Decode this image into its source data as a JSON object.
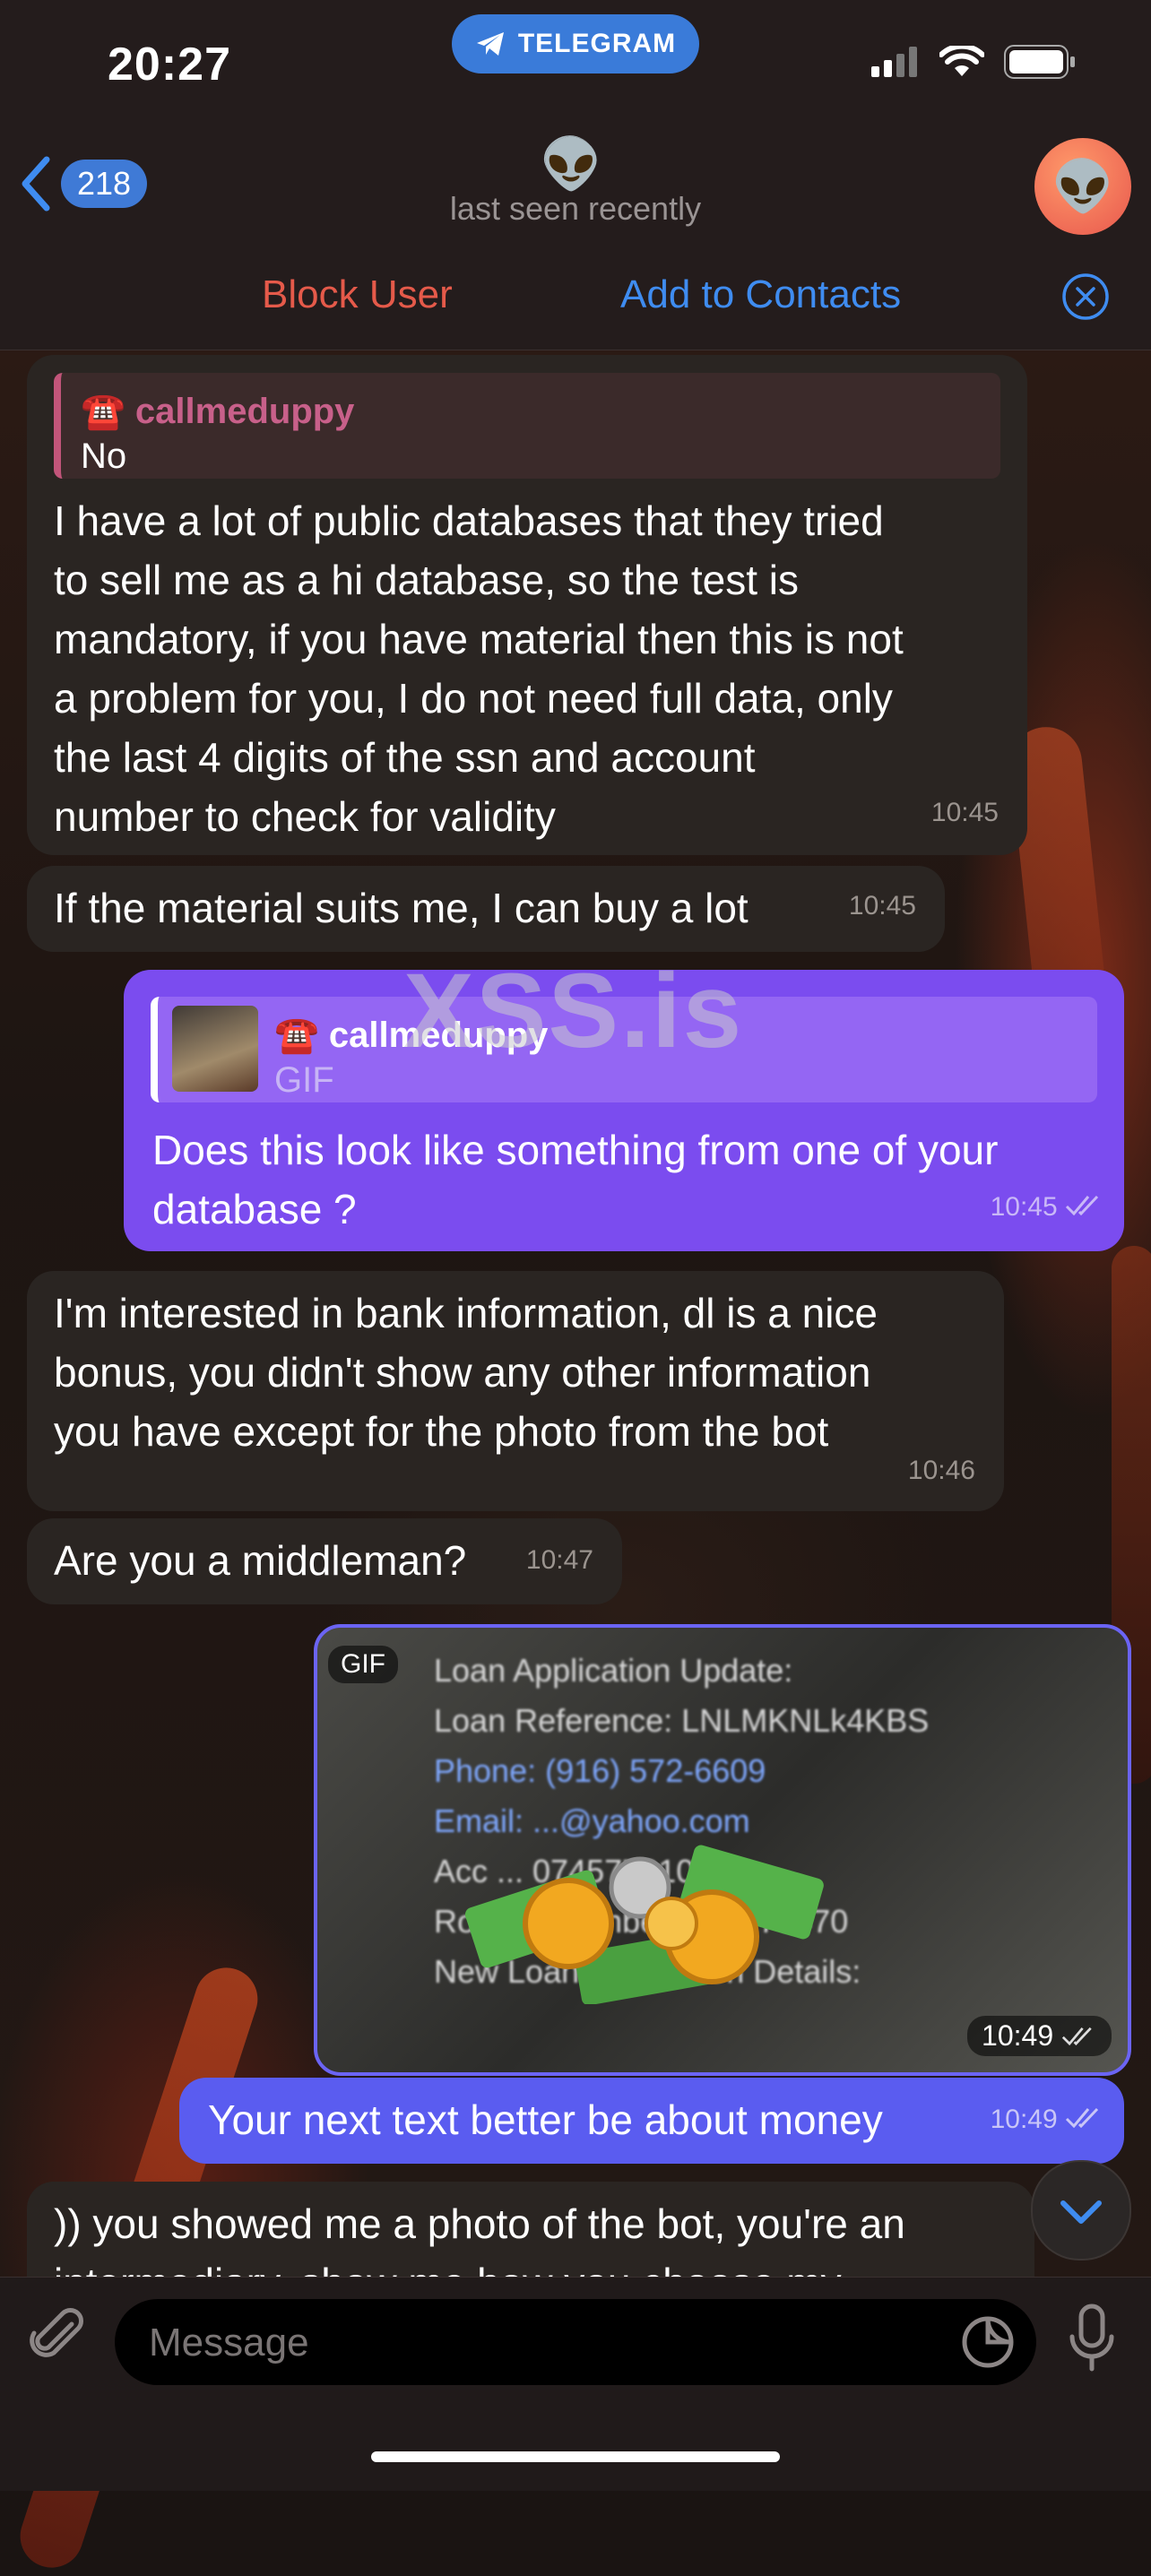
{
  "status_bar": {
    "time": "20:27",
    "app_pill": "TELEGRAM"
  },
  "header": {
    "back_count": "218",
    "peer_emoji": "👽",
    "status": "last seen recently",
    "avatar_emoji": "👽"
  },
  "action_bar": {
    "block_label": "Block User",
    "add_contacts_label": "Add to Contacts"
  },
  "messages": [
    {
      "reply_name": "☎️ callmeduppy",
      "reply_text": "No",
      "lines": [
        "I have a lot of public databases that they tried",
        "to sell me as a hi database, so the test is",
        "mandatory, if you have material then this is not",
        "a problem for you, I do not need full data, only",
        "the last 4 digits of the ssn and account",
        "number to check for validity"
      ],
      "time": "10:45"
    },
    {
      "text": "If the material suits me, I can buy a lot",
      "time": "10:45"
    },
    {
      "reply_name": "☎️ callmeduppy",
      "reply_text": "GIF",
      "lines": [
        "Does this look like something from one of your",
        "database ?"
      ],
      "time": "10:45"
    },
    {
      "lines": [
        "I'm interested in bank information, dl is a nice",
        "bonus, you didn't show any other information",
        "you have except for the photo from the bot"
      ],
      "time": "10:46"
    },
    {
      "text": "Are you a middleman?",
      "time": "10:47"
    },
    {
      "gif_tag": "GIF",
      "gif_lines": [
        "Loan Application Update:",
        "Loan Reference: LNLMKNLk4KBS",
        "Phone: (916) 572-6609",
        "Email: ...@yahoo.com",
        "Acc ... 074577610",
        "Routing Number: 321076470",
        "New Loan Application Details:"
      ],
      "time": "10:49"
    },
    {
      "text": "Your next text better be about money",
      "time": "10:49"
    },
    {
      "lines": [
        ")) you showed me a photo of the bot, you're an",
        "intermediary, show me how you choose my"
      ]
    }
  ],
  "watermark": "XSS.is",
  "input": {
    "placeholder": "Message"
  },
  "colors": {
    "accent": "#3f8cf0",
    "block_red": "#e55a4a",
    "outgoing_bubble": "#7b4cef",
    "incoming_bubble": "#2a2522"
  }
}
